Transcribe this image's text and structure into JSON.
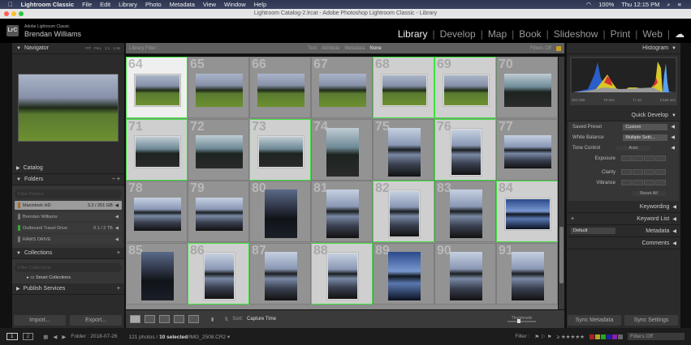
{
  "menubar": {
    "app": "Lightroom Classic",
    "items": [
      "File",
      "Edit",
      "Library",
      "Photo",
      "Metadata",
      "View",
      "Window",
      "Help"
    ],
    "battery": "100%",
    "clock": "Thu 12:15 PM"
  },
  "window_title": "Lightroom Catalog-2.lrcat - Adobe Photoshop Lightroom Classic - Library",
  "identity": {
    "product": "Adobe Lightroom Classic",
    "user": "Brendan Williams",
    "logo": "LrC"
  },
  "modules": [
    "Library",
    "Develop",
    "Map",
    "Book",
    "Slideshow",
    "Print",
    "Web"
  ],
  "left": {
    "navigator": "Navigator",
    "zoom_opts": [
      "FIT",
      "FILL",
      "1:1",
      "1:16"
    ],
    "catalog": "Catalog",
    "folders": "Folders",
    "folder_filter": "Filter Folders",
    "folder_list": [
      {
        "name": "Macintosh HD",
        "size": "3.2 / 251 GB"
      },
      {
        "name": "Brendan Williams",
        "size": ""
      },
      {
        "name": "Outbound Travel Drive",
        "size": "0.1 / 2 TB"
      },
      {
        "name": "RAWS DRIVE",
        "size": ""
      }
    ],
    "collections": "Collections",
    "collection_filter": "Filter Collections",
    "smart_collections": "Smart Collections",
    "publish": "Publish Services",
    "import": "Import...",
    "export": "Export..."
  },
  "filter": {
    "label": "Library Filter :",
    "tabs": [
      "Text",
      "Attribute",
      "Metadata",
      "None"
    ],
    "status": "Filters Off"
  },
  "grid": [
    {
      "n": "64",
      "o": "l",
      "s": "meadow",
      "sel": "primary"
    },
    {
      "n": "65",
      "o": "l",
      "s": "meadow",
      "sel": ""
    },
    {
      "n": "66",
      "o": "l",
      "s": "meadow",
      "sel": ""
    },
    {
      "n": "67",
      "o": "l",
      "s": "meadow",
      "sel": ""
    },
    {
      "n": "68",
      "o": "l",
      "s": "meadow",
      "sel": "sel"
    },
    {
      "n": "69",
      "o": "l",
      "s": "meadow",
      "sel": "sel"
    },
    {
      "n": "70",
      "o": "l",
      "s": "road",
      "sel": ""
    },
    {
      "n": "71",
      "o": "l",
      "s": "road",
      "sel": "sel"
    },
    {
      "n": "72",
      "o": "l",
      "s": "road",
      "sel": ""
    },
    {
      "n": "73",
      "o": "l",
      "s": "road",
      "sel": "sel"
    },
    {
      "n": "74",
      "o": "p",
      "s": "road",
      "sel": ""
    },
    {
      "n": "75",
      "o": "p",
      "s": "lake",
      "sel": ""
    },
    {
      "n": "76",
      "o": "p",
      "s": "lake",
      "sel": "sel"
    },
    {
      "n": "77",
      "o": "l",
      "s": "lake",
      "sel": ""
    },
    {
      "n": "78",
      "o": "l",
      "s": "lake",
      "sel": ""
    },
    {
      "n": "79",
      "o": "l",
      "s": "lake",
      "sel": ""
    },
    {
      "n": "80",
      "o": "p",
      "s": "dusk",
      "sel": ""
    },
    {
      "n": "81",
      "o": "p",
      "s": "lake",
      "sel": ""
    },
    {
      "n": "82",
      "o": "p",
      "s": "lake",
      "sel": "sel"
    },
    {
      "n": "83",
      "o": "p",
      "s": "lake",
      "sel": ""
    },
    {
      "n": "84",
      "o": "l",
      "s": "blue",
      "sel": "sel"
    },
    {
      "n": "85",
      "o": "p",
      "s": "dusk",
      "sel": ""
    },
    {
      "n": "86",
      "o": "p",
      "s": "lake",
      "sel": "sel"
    },
    {
      "n": "87",
      "o": "p",
      "s": "lake",
      "sel": ""
    },
    {
      "n": "88",
      "o": "p",
      "s": "lake",
      "sel": "sel"
    },
    {
      "n": "89",
      "o": "p",
      "s": "blue",
      "sel": ""
    },
    {
      "n": "90",
      "o": "p",
      "s": "lake",
      "sel": ""
    },
    {
      "n": "91",
      "o": "p",
      "s": "lake",
      "sel": ""
    }
  ],
  "toolbar": {
    "sort_label": "Sort:",
    "sort_value": "Capture Time",
    "thumbnails": "Thumbnails"
  },
  "right": {
    "histogram": "Histogram",
    "iso": "ISO 250",
    "focal": "70 mm",
    "aperture": "f / 10",
    "shutter": "1/160 sec",
    "quick_develop": "Quick Develop",
    "saved_preset": "Saved Preset",
    "saved_preset_val": "Custom",
    "white_balance": "White Balance",
    "white_balance_val": "Multiple Setti...",
    "tone_control": "Tone Control",
    "auto": "Auto",
    "exposure": "Exposure",
    "clarity": "Clarity",
    "vibrance": "Vibrance",
    "reset": "Reset All",
    "keywording": "Keywording",
    "keyword_list": "Keyword List",
    "metadata": "Metadata",
    "metadata_preset": "Default",
    "comments": "Comments",
    "sync_metadata": "Sync Metadata",
    "sync_settings": "Sync Settings"
  },
  "filmstrip": {
    "screen1": "1",
    "screen2": "2",
    "folder": "Folder : 2018-07-26",
    "count": "121 photos /",
    "selected": "10 selected",
    "file": "/IMG_2508.CR2",
    "filter_label": "Filter :",
    "filters_off": "Filters Off"
  }
}
